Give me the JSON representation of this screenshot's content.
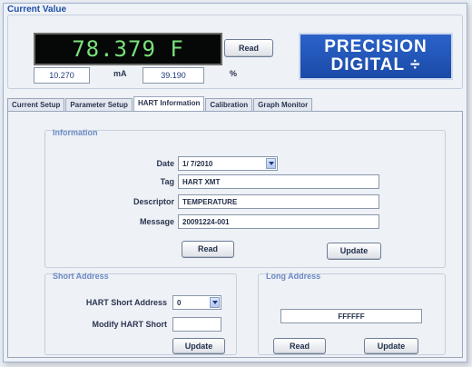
{
  "window": {
    "title": "Current Value"
  },
  "current_value": {
    "display": "78.379  F",
    "read_button": "Read",
    "ma_value": "10.270",
    "ma_unit": "mA",
    "percent_value": "39.190",
    "percent_unit": "%"
  },
  "logo": {
    "line1": "PRECISION",
    "line2": "DIGITAL ÷"
  },
  "tabs": [
    {
      "label": "Current Setup"
    },
    {
      "label": "Parameter Setup"
    },
    {
      "label": "HART Information"
    },
    {
      "label": "Calibration"
    },
    {
      "label": "Graph Monitor"
    }
  ],
  "active_tab": "HART Information",
  "information": {
    "label": "Information",
    "date_label": "Date",
    "date_value": "1/ 7/2010",
    "tag_label": "Tag",
    "tag_value": "HART XMT",
    "descriptor_label": "Descriptor",
    "descriptor_value": "TEMPERATURE",
    "message_label": "Message",
    "message_value": "20091224-001",
    "read_button": "Read",
    "update_button": "Update"
  },
  "short_address": {
    "label": "Short Address",
    "hart_short_label": "HART Short Address",
    "hart_short_value": "0",
    "modify_label": "Modify HART Short",
    "modify_value": "",
    "update_button": "Update"
  },
  "long_address": {
    "label": "Long Address",
    "value": "FFFFFF",
    "read_button": "Read",
    "update_button": "Update"
  },
  "colors": {
    "accent": "#1f4fa8",
    "lcd_text": "#7be07b",
    "logo_bg": "#1b4aa8",
    "group_label": "#6b89c5"
  }
}
